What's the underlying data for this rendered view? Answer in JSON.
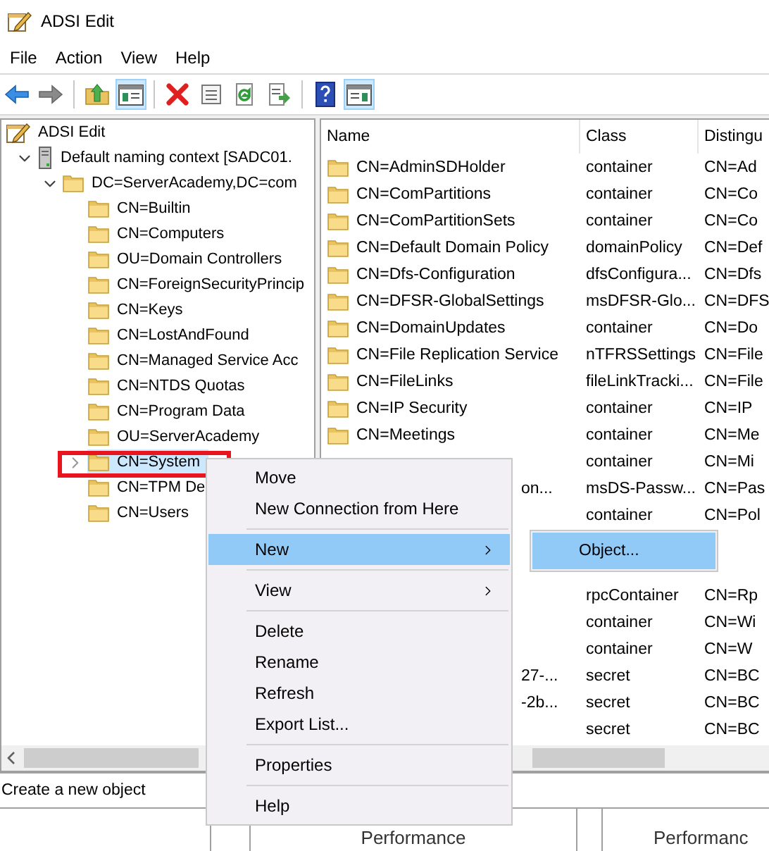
{
  "window": {
    "title": "ADSI Edit"
  },
  "menu_bar": [
    "File",
    "Action",
    "View",
    "Help"
  ],
  "toolbar": [
    [
      {
        "kind": "back",
        "selected": false
      },
      {
        "kind": "forward",
        "selected": false
      }
    ],
    [
      {
        "kind": "up",
        "selected": false
      },
      {
        "kind": "tree-pane",
        "selected": true
      }
    ],
    [
      {
        "kind": "delete",
        "selected": false
      },
      {
        "kind": "properties",
        "selected": false
      },
      {
        "kind": "refresh",
        "selected": false
      },
      {
        "kind": "export",
        "selected": false
      }
    ],
    [
      {
        "kind": "help",
        "selected": false
      },
      {
        "kind": "action-pane",
        "selected": true
      }
    ]
  ],
  "tree": [
    {
      "label": "ADSI Edit",
      "selected": false,
      "children": [
        {
          "label": "Default naming context [SADC01.",
          "selected": false,
          "expanded": true,
          "children": [
            {
              "label": "DC=ServerAcademy,DC=com",
              "selected": false,
              "expanded": true,
              "children": [
                {
                  "label": "CN=Builtin",
                  "selected": false
                },
                {
                  "label": "CN=Computers",
                  "selected": false
                },
                {
                  "label": "OU=Domain Controllers",
                  "selected": false
                },
                {
                  "label": "CN=ForeignSecurityPrincip",
                  "selected": false
                },
                {
                  "label": "CN=Keys",
                  "selected": false
                },
                {
                  "label": "CN=LostAndFound",
                  "selected": false
                },
                {
                  "label": "CN=Managed Service Acc",
                  "selected": false
                },
                {
                  "label": "CN=NTDS Quotas",
                  "selected": false
                },
                {
                  "label": "CN=Program Data",
                  "selected": false
                },
                {
                  "label": "OU=ServerAcademy",
                  "selected": false
                },
                {
                  "label": "CN=System",
                  "selected": true,
                  "expanded": false,
                  "highlighted": true
                },
                {
                  "label": "CN=TPM De",
                  "selected": false
                },
                {
                  "label": "CN=Users",
                  "selected": false
                }
              ]
            }
          ]
        }
      ]
    }
  ],
  "list": {
    "columns": [
      "Name",
      "Class",
      "Distingu"
    ],
    "rows": [
      {
        "kind": "full",
        "name": "CN=AdminSDHolder",
        "class": "container",
        "dn": "CN=Ad"
      },
      {
        "kind": "full",
        "name": "CN=ComPartitions",
        "class": "container",
        "dn": "CN=Co"
      },
      {
        "kind": "full",
        "name": "CN=ComPartitionSets",
        "class": "container",
        "dn": "CN=Co"
      },
      {
        "kind": "full",
        "name": "CN=Default Domain Policy",
        "class": "domainPolicy",
        "dn": "CN=Def"
      },
      {
        "kind": "full",
        "name": "CN=Dfs-Configuration",
        "class": "dfsConfigura...",
        "dn": "CN=Dfs"
      },
      {
        "kind": "full",
        "name": "CN=DFSR-GlobalSettings",
        "class": "msDFSR-Glo...",
        "dn": "CN=DFS"
      },
      {
        "kind": "full",
        "name": "CN=DomainUpdates",
        "class": "container",
        "dn": "CN=Do"
      },
      {
        "kind": "full",
        "name": "CN=File Replication Service",
        "class": "nTFRSSettings",
        "dn": "CN=File"
      },
      {
        "kind": "full",
        "name": "CN=FileLinks",
        "class": "fileLinkTracki...",
        "dn": "CN=File"
      },
      {
        "kind": "full",
        "name": "CN=IP Security",
        "class": "container",
        "dn": "CN=IP"
      },
      {
        "kind": "full",
        "name": "CN=Meetings",
        "class": "container",
        "dn": "CN=Me"
      },
      {
        "kind": "hidden",
        "class": "container",
        "dn": "CN=Mi"
      },
      {
        "kind": "tail",
        "name": "on...",
        "class": "msDS-Passw...",
        "dn": "CN=Pas"
      },
      {
        "kind": "hidden",
        "class": "container",
        "dn": "CN=Pol"
      },
      {
        "kind": "hidden"
      },
      {
        "kind": "hidden"
      },
      {
        "kind": "hidden",
        "class": "rpcContainer",
        "dn": "CN=Rp"
      },
      {
        "kind": "hidden",
        "class": "container",
        "dn": "CN=Wi"
      },
      {
        "kind": "hidden",
        "class": "container",
        "dn": "CN=W"
      },
      {
        "kind": "tail",
        "name": "27-...",
        "class": "secret",
        "dn": "CN=BC"
      },
      {
        "kind": "tail",
        "name": "-2b...",
        "class": "secret",
        "dn": "CN=BC"
      },
      {
        "kind": "hidden",
        "class": "secret",
        "dn": "CN=BC"
      }
    ]
  },
  "context_menu": [
    {
      "kind": "item",
      "label": "Move",
      "selected": false
    },
    {
      "kind": "item",
      "label": "New Connection from Here",
      "selected": false
    },
    {
      "kind": "separator"
    },
    {
      "kind": "submenu",
      "label": "New",
      "selected": true
    },
    {
      "kind": "separator"
    },
    {
      "kind": "submenu",
      "label": "View",
      "selected": false
    },
    {
      "kind": "separator"
    },
    {
      "kind": "item",
      "label": "Delete",
      "selected": false
    },
    {
      "kind": "item",
      "label": "Rename",
      "selected": false
    },
    {
      "kind": "item",
      "label": "Refresh",
      "selected": false
    },
    {
      "kind": "item",
      "label": "Export List...",
      "selected": false
    },
    {
      "kind": "separator"
    },
    {
      "kind": "item",
      "label": "Properties",
      "selected": false
    },
    {
      "kind": "separator"
    },
    {
      "kind": "item",
      "label": "Help",
      "selected": false
    }
  ],
  "submenu": [
    {
      "label": "Object...",
      "selected": true
    }
  ],
  "status_bar": "Create a new object",
  "bottom_panel": [
    "Performance",
    "Performanc"
  ]
}
